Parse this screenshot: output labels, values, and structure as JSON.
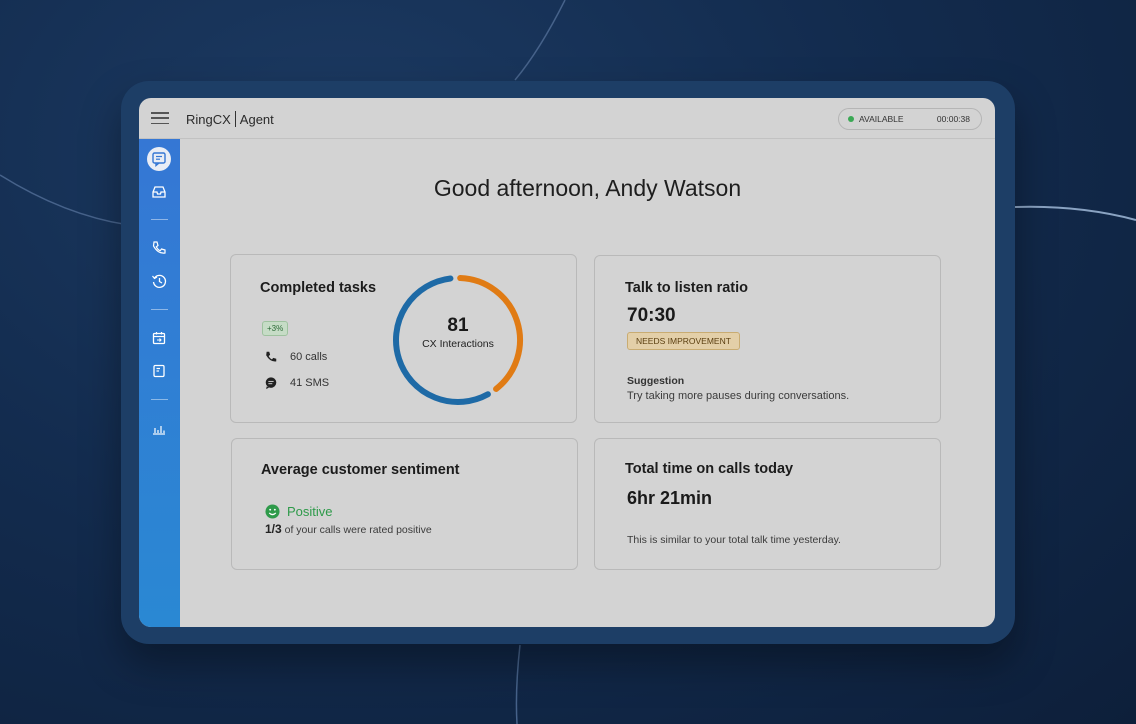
{
  "app": {
    "brand": "RingCX",
    "module": "Agent",
    "status": "AVAILABLE",
    "timer": "00:00:38",
    "status_color": "#3aa854",
    "accent": "#3577d4"
  },
  "sidebar": {
    "items": [
      {
        "icon": "chat-icon",
        "active": true
      },
      {
        "icon": "inbox-icon"
      },
      {
        "icon": "phone-icon"
      },
      {
        "icon": "history-icon"
      },
      {
        "icon": "calendar-icon"
      },
      {
        "icon": "notes-icon"
      },
      {
        "icon": "analytics-icon"
      }
    ]
  },
  "greeting": "Good afternoon, Andy Watson",
  "completed_tasks": {
    "title": "Completed tasks",
    "delta": "+3%",
    "calls": "60 calls",
    "sms": "41 SMS",
    "total": "81",
    "total_label": "CX Interactions",
    "calls_count": 60,
    "sms_count": 41,
    "colors": {
      "calls": "#1e6aa6",
      "sms": "#e07b14"
    }
  },
  "talk_ratio": {
    "title": "Talk to listen ratio",
    "value": "70:30",
    "badge": "NEEDS IMPROVEMENT",
    "suggestion_label": "Suggestion",
    "suggestion": "Try taking more pauses during conversations."
  },
  "sentiment": {
    "title": "Average customer sentiment",
    "value": "Positive",
    "fraction": "1/3",
    "detail": "of your calls were rated positive",
    "color": "#2e9a4a"
  },
  "call_time": {
    "title": "Total time on calls today",
    "value": "6hr 21min",
    "note": "This is similar to your total talk time yesterday."
  }
}
